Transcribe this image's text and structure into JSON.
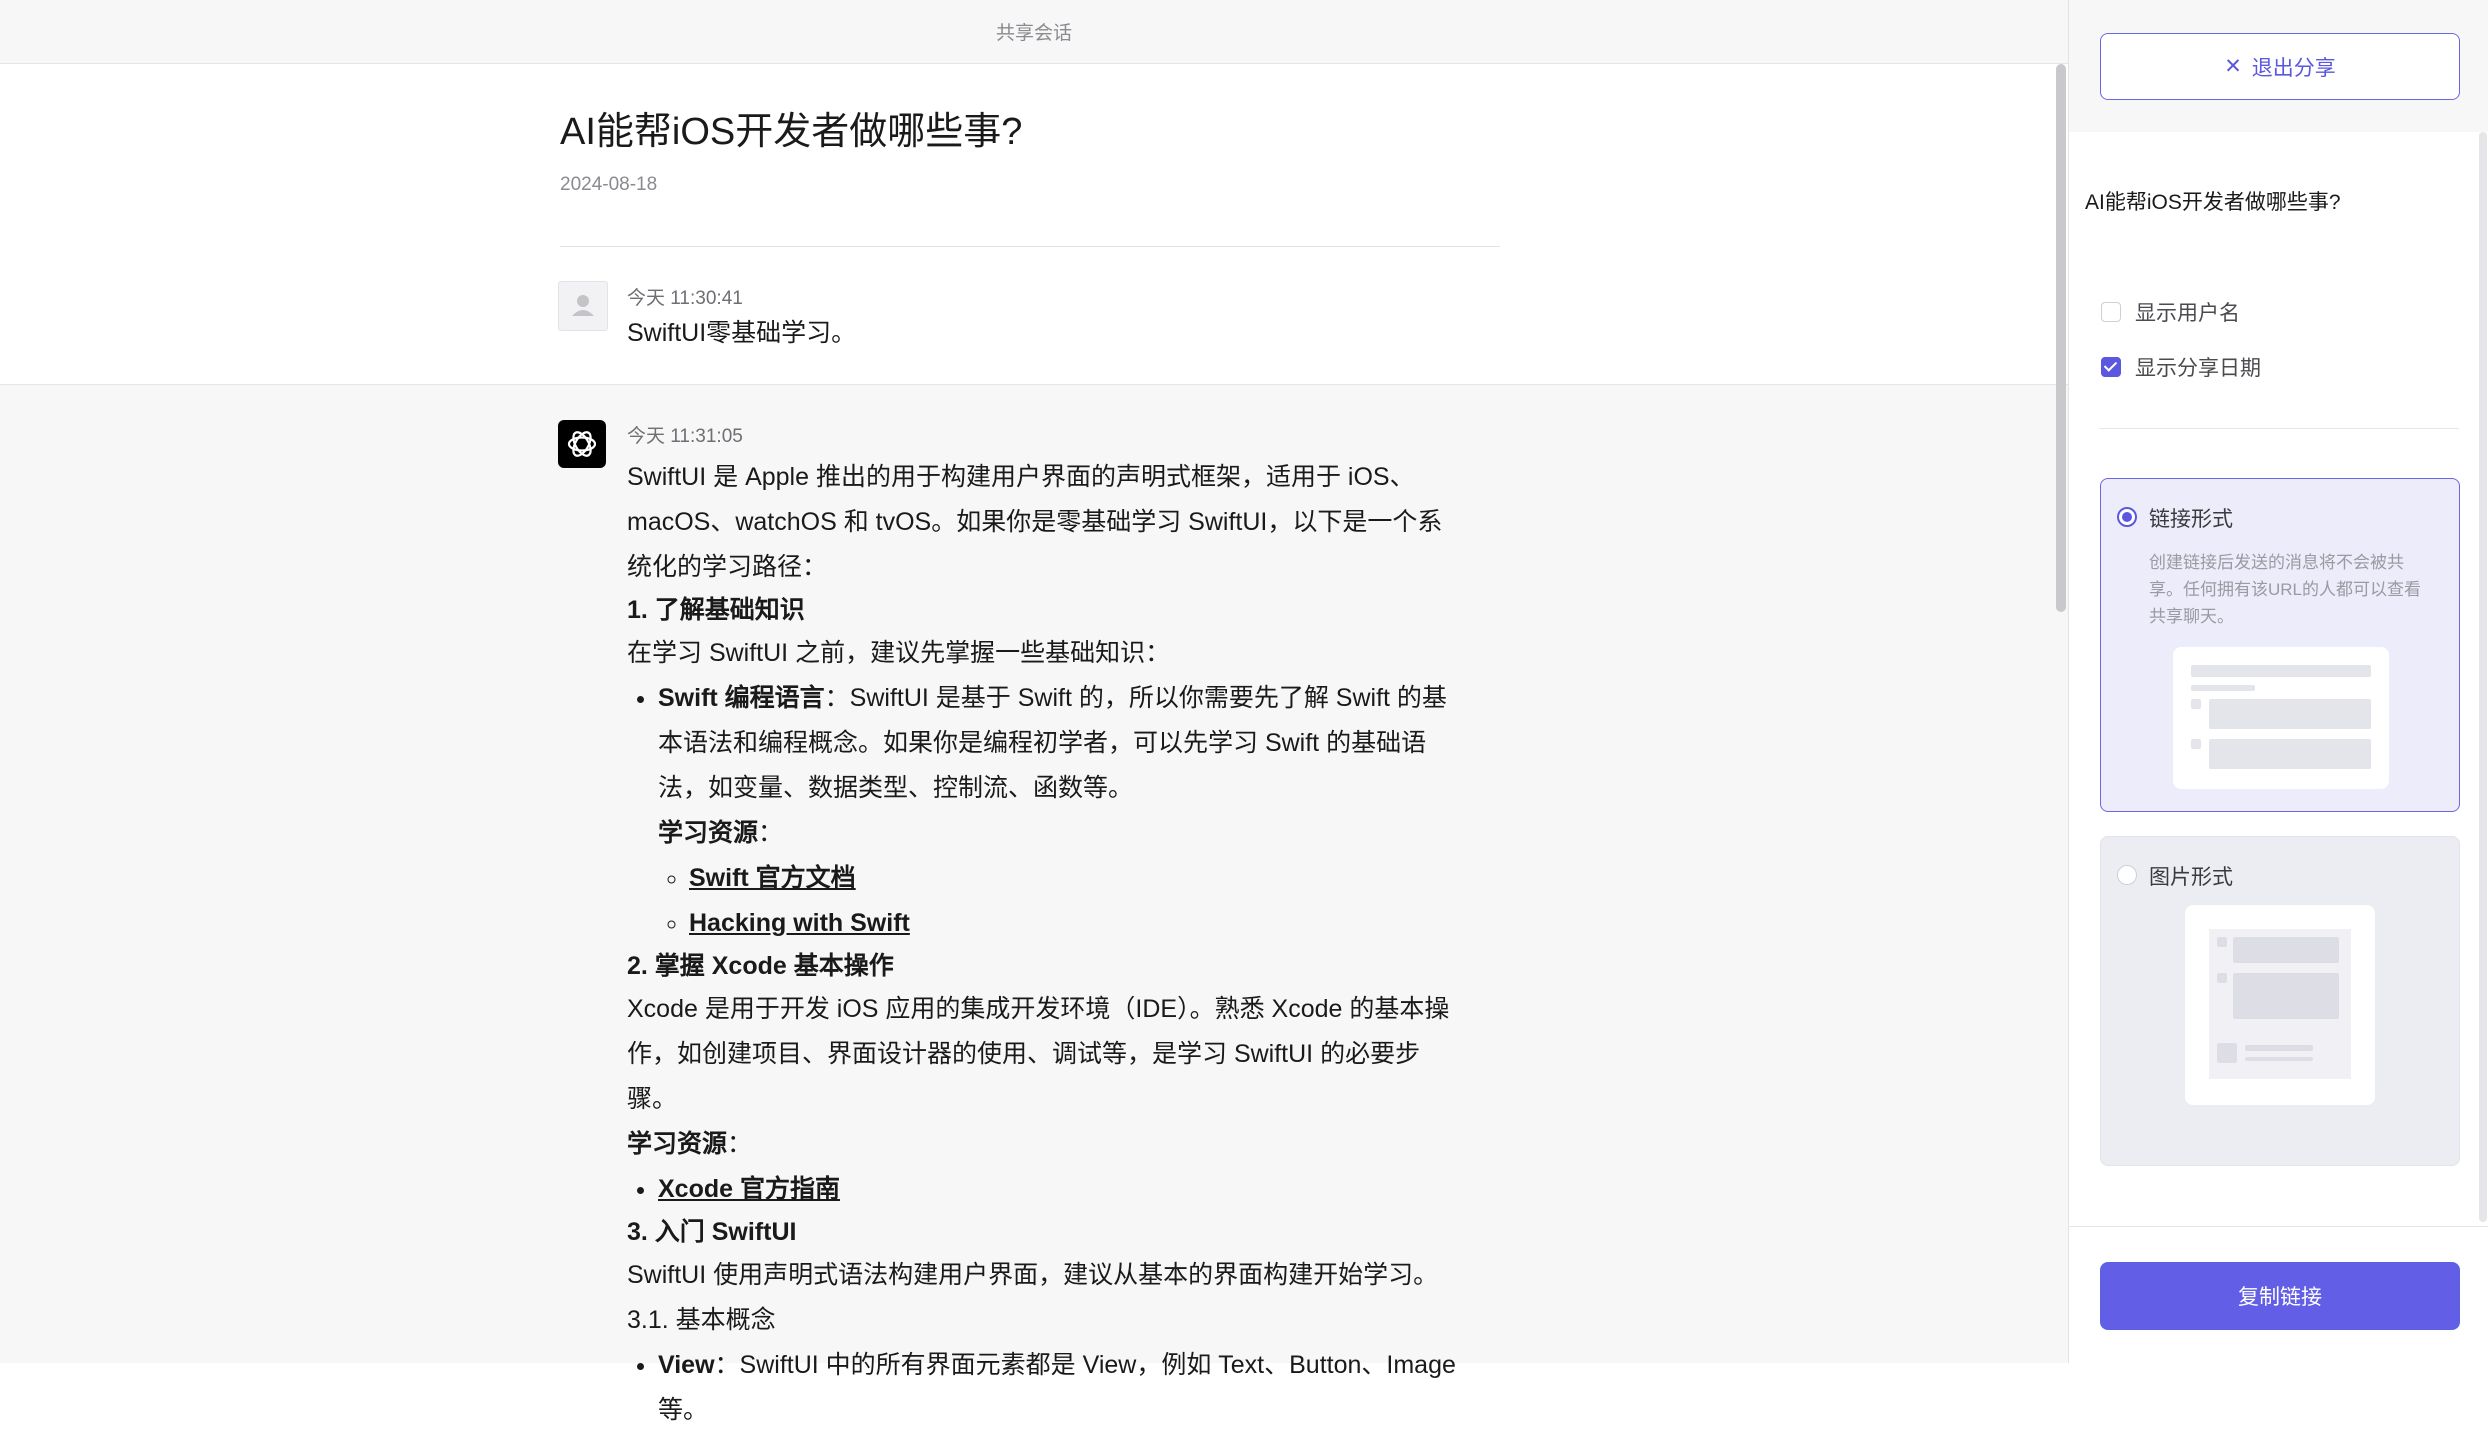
{
  "topbar": {
    "title": "共享会话"
  },
  "conversation": {
    "title": "AI能帮iOS开发者做哪些事?",
    "date": "2024-08-18"
  },
  "user_message": {
    "time": "今天 11:30:41",
    "text": "SwiftUI零基础学习。"
  },
  "ai_message": {
    "time": "今天 11:31:05",
    "intro": "SwiftUI 是 Apple 推出的用于构建用户界面的声明式框架，适用于 iOS、macOS、watchOS 和 tvOS。如果你是零基础学习 SwiftUI，以下是一个系统化的学习路径：",
    "s1_heading": "1. 了解基础知识",
    "s1_text": "在学习 SwiftUI 之前，建议先掌握一些基础知识：",
    "s1_item_bold": "Swift 编程语言",
    "s1_item_text": "：SwiftUI 是基于 Swift 的，所以你需要先了解 Swift 的基本语法和编程概念。如果你是编程初学者，可以先学习 Swift 的基础语法，如变量、数据类型、控制流、函数等。",
    "s1_res_label": "学习资源",
    "colon": "：",
    "s1_link1": "Swift 官方文档",
    "s1_link2": "Hacking with Swift",
    "s2_heading": "2. 掌握 Xcode 基本操作",
    "s2_text": "Xcode 是用于开发 iOS 应用的集成开发环境（IDE）。熟悉 Xcode 的基本操作，如创建项目、界面设计器的使用、调试等，是学习 SwiftUI 的必要步骤。",
    "s2_res_label": "学习资源",
    "s2_link1": "Xcode 官方指南",
    "s3_heading": "3. 入门 SwiftUI",
    "s3_text": "SwiftUI 使用声明式语法构建用户界面，建议从基本的界面构建开始学习。",
    "s31_heading": "3.1. 基本概念",
    "s31_item_bold": "View",
    "s31_item_text": "：SwiftUI 中的所有界面元素都是 View，例如 Text、Button、Image 等。"
  },
  "panel": {
    "exit_label": "退出分享",
    "title": "AI能帮iOS开发者做哪些事?",
    "show_username_label": "显示用户名",
    "show_username_checked": false,
    "show_date_label": "显示分享日期",
    "show_date_checked": true,
    "option_link_label": "链接形式",
    "option_link_desc": "创建链接后发送的消息将不会被共享。任何拥有该URL的人都可以查看共享聊天。",
    "option_link_selected": true,
    "option_image_label": "图片形式",
    "option_image_selected": false,
    "copy_label": "复制链接"
  },
  "colors": {
    "accent": "#5b57df",
    "button": "#625fe6"
  }
}
